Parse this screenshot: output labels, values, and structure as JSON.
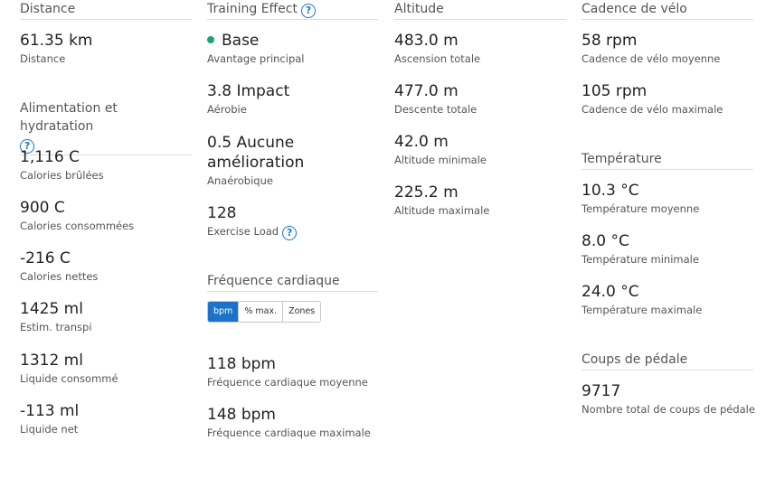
{
  "distance": {
    "title": "Distance",
    "value": "61.35 km",
    "label": "Distance"
  },
  "nutrition": {
    "title": "Alimentation et hydratation",
    "help_icon": "?",
    "stats": [
      {
        "value": "1,116 C",
        "label": "Calories brûlées"
      },
      {
        "value": "900 C",
        "label": "Calories consommées"
      },
      {
        "value": "-216 C",
        "label": "Calories nettes"
      },
      {
        "value": "1425 ml",
        "label": "Estim. transpi"
      },
      {
        "value": "1312 ml",
        "label": "Liquide consommé"
      },
      {
        "value": "-113 ml",
        "label": "Liquide net"
      }
    ]
  },
  "training_effect": {
    "title": "Training Effect",
    "help_icon": "?",
    "primary_value": "Base",
    "primary_label": "Avantage principal",
    "primary_dot_color": "#1aa37a",
    "aerobic_value": "3.8 Impact",
    "aerobic_label": "Aérobie",
    "anaerobic_value": "0.5 Aucune amélioration",
    "anaerobic_label": "Anaérobique",
    "load_value": "128",
    "load_label": "Exercise Load",
    "load_help_icon": "?"
  },
  "heart_rate": {
    "title": "Fréquence cardiaque",
    "tabs": [
      "bpm",
      "% max.",
      "Zones"
    ],
    "active_tab": "bpm",
    "accent_color": "#1a73c8",
    "stats": [
      {
        "value": "118 bpm",
        "label": "Fréquence cardiaque moyenne"
      },
      {
        "value": "148 bpm",
        "label": "Fréquence cardiaque maximale"
      }
    ]
  },
  "altitude": {
    "title": "Altitude",
    "stats": [
      {
        "value": "483.0 m",
        "label": "Ascension totale"
      },
      {
        "value": "477.0 m",
        "label": "Descente totale"
      },
      {
        "value": "42.0 m",
        "label": "Altitude minimale"
      },
      {
        "value": "225.2 m",
        "label": "Altitude maximale"
      }
    ]
  },
  "cadence": {
    "title": "Cadence de vélo",
    "stats": [
      {
        "value": "58 rpm",
        "label": "Cadence de vélo moyenne"
      },
      {
        "value": "105 rpm",
        "label": "Cadence de vélo maximale"
      }
    ]
  },
  "temperature": {
    "title": "Température",
    "stats": [
      {
        "value": "10.3 °C",
        "label": "Température moyenne"
      },
      {
        "value": "8.0 °C",
        "label": "Température minimale"
      },
      {
        "value": "24.0 °C",
        "label": "Température maximale"
      }
    ]
  },
  "strokes": {
    "title": "Coups de pédale",
    "value": "9717",
    "label": "Nombre total de coups de pédale"
  }
}
